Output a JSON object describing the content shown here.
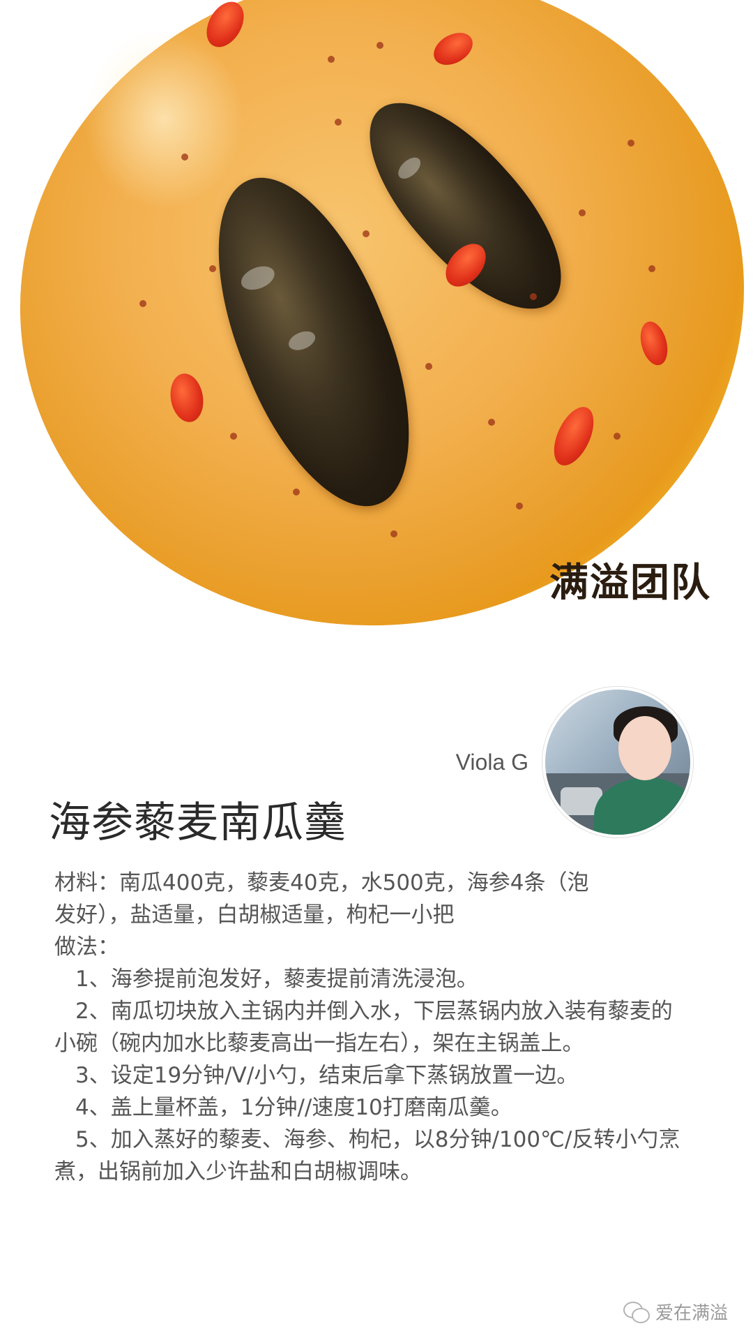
{
  "hero": {
    "image_alt": "海参藜麦南瓜羹成品图",
    "watermark": "满溢团队"
  },
  "author": {
    "name": "Viola G",
    "avatar_icon": "avatar-photo"
  },
  "recipe": {
    "title": "海参藜麦南瓜羹",
    "ingredients_line1": "材料：南瓜400克，藜麦40克，水500克，海参4条（泡",
    "ingredients_line2": "发好），盐适量，白胡椒适量，枸杞一小把",
    "method_label": "做法：",
    "steps": [
      "1、海参提前泡发好，藜麦提前清洗浸泡。",
      "2、南瓜切块放入主锅内并倒入水，下层蒸锅内放入装有藜麦的小碗（碗内加水比藜麦高出一指左右），架在主锅盖上。",
      "3、设定19分钟/V/小勺，结束后拿下蒸锅放置一边。",
      "4、盖上量杯盖，1分钟//速度10打磨南瓜羹。",
      "5、加入蒸好的藜麦、海参、枸杞，以8分钟/100℃/反转小勺烹煮，出锅前加入少许盐和白胡椒调味。"
    ]
  },
  "footer": {
    "account": "爱在满溢",
    "icon": "wechat-icon"
  },
  "colors": {
    "soup": "#f3b04f",
    "text": "#555555",
    "title": "#2a2a2a"
  }
}
